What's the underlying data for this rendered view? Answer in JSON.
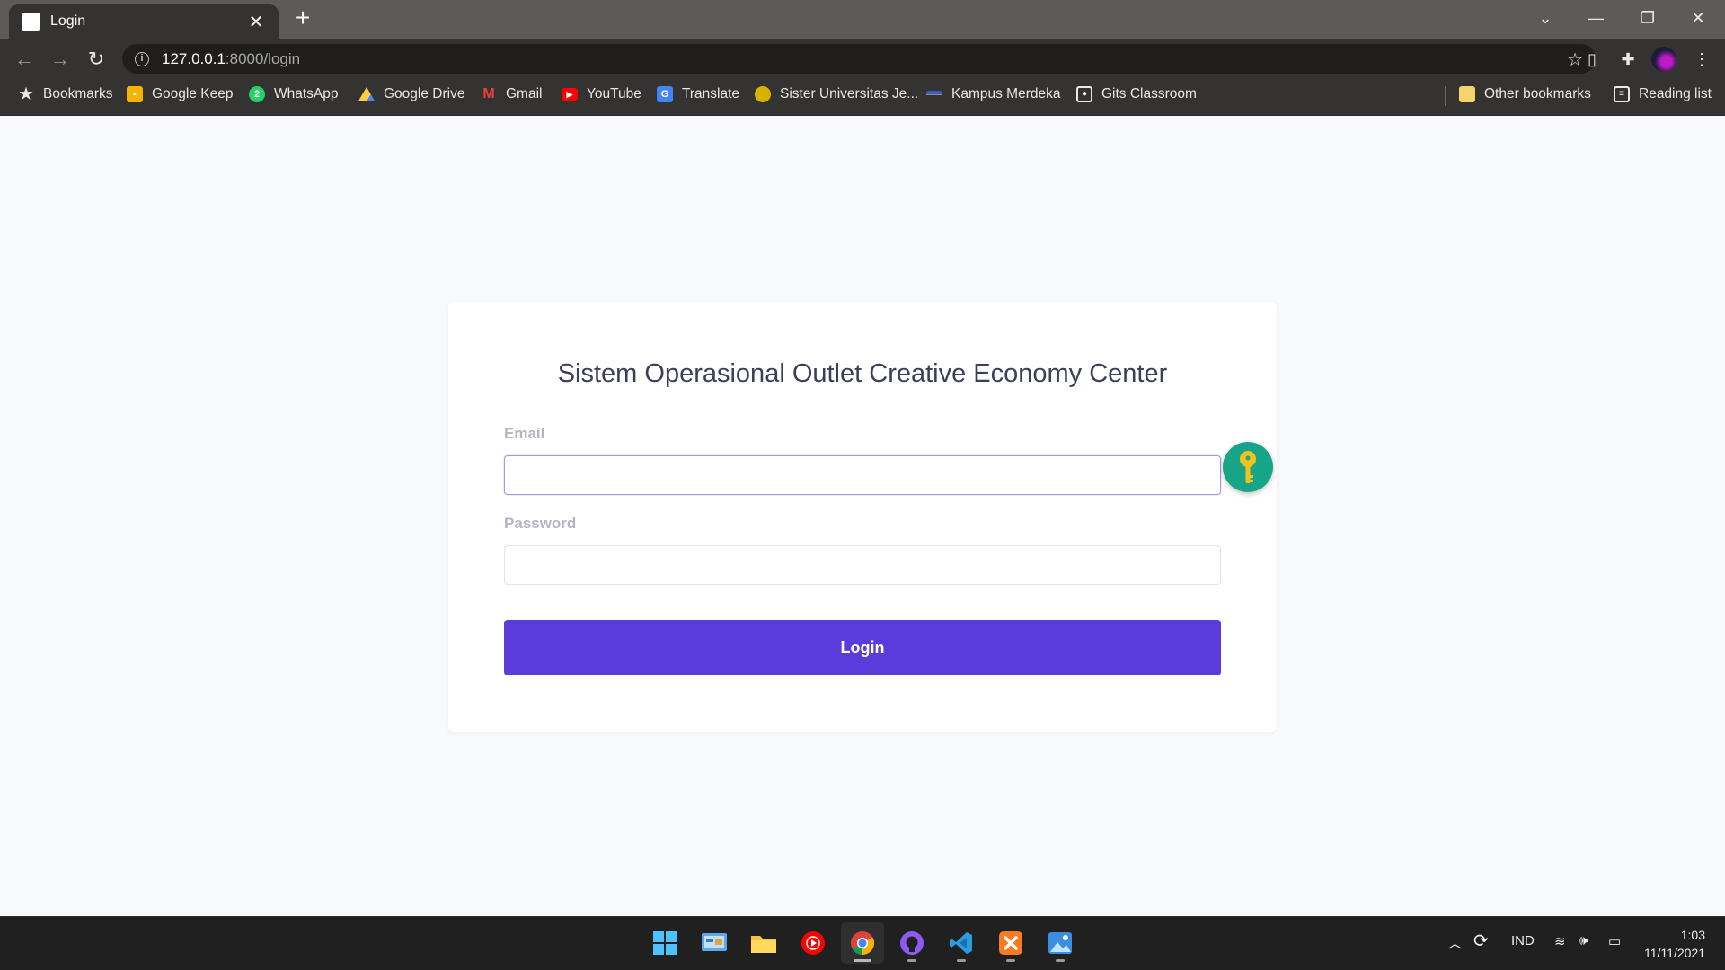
{
  "browser": {
    "tab_title": "Login",
    "new_tab_label": "+",
    "url_host": "127.0.0.1",
    "url_path": ":8000/login"
  },
  "bookmarks": [
    {
      "label": "Bookmarks",
      "icon": "star-icon",
      "color": "#e8e8e8"
    },
    {
      "label": "Google Keep",
      "icon": "google-keep-icon",
      "color": "#f6b400"
    },
    {
      "label": "WhatsApp",
      "icon": "whatsapp-icon",
      "color": "#25d366"
    },
    {
      "label": "Google Drive",
      "icon": "google-drive-icon",
      "color": "#1fa463"
    },
    {
      "label": "Gmail",
      "icon": "gmail-icon",
      "color": "#ea4335"
    },
    {
      "label": "YouTube",
      "icon": "youtube-icon",
      "color": "#ff0000"
    },
    {
      "label": "Translate",
      "icon": "google-translate-icon",
      "color": "#4285f4"
    },
    {
      "label": "Sister Universitas Je...",
      "icon": "university-icon",
      "color": "#d4b300"
    },
    {
      "label": "Kampus Merdeka",
      "icon": "kampus-merdeka-icon",
      "color": "#3a5bbf"
    },
    {
      "label": "Gits Classroom",
      "icon": "classroom-icon",
      "color": "#e8e8e8"
    },
    {
      "label": "Other bookmarks",
      "icon": "folder-icon",
      "color": "#f6d36b"
    },
    {
      "label": "Reading list",
      "icon": "reading-list-icon",
      "color": "#e8e8e8"
    }
  ],
  "login": {
    "title": "Sistem Operasional Outlet Creative Economy Center",
    "email_label": "Email",
    "email_value": "",
    "password_label": "Password",
    "password_value": "",
    "submit_label": "Login"
  },
  "colors": {
    "accent": "#5a3bdc",
    "page_bg": "#f8f9fd",
    "password_manager": "#17a589"
  },
  "taskbar": {
    "apps": [
      {
        "name": "start-icon",
        "active": false
      },
      {
        "name": "control-panel-icon",
        "active": false
      },
      {
        "name": "file-explorer-icon",
        "active": false
      },
      {
        "name": "youtube-music-icon",
        "active": false
      },
      {
        "name": "chrome-icon",
        "active": true
      },
      {
        "name": "github-desktop-icon",
        "active": false
      },
      {
        "name": "vscode-icon",
        "active": false
      },
      {
        "name": "xampp-icon",
        "active": false
      },
      {
        "name": "photos-icon",
        "active": false
      }
    ],
    "language": "IND",
    "time": "1:03",
    "date": "11/11/2021"
  }
}
